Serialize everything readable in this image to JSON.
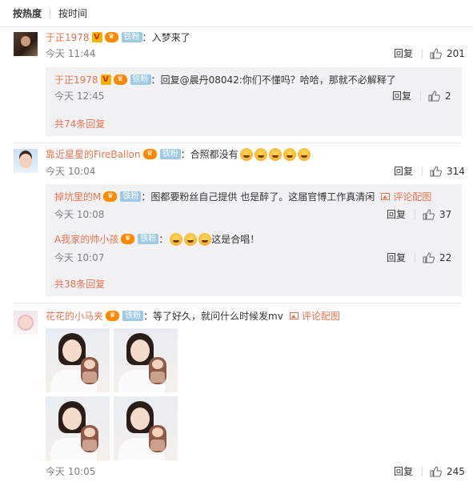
{
  "sort_bar": {
    "hot_label": "按热度",
    "time_label": "按时间"
  },
  "icons": {
    "like": "thumbs-up-icon",
    "pic": "image-icon",
    "verified": "verified-v-icon",
    "crown": "vip-crown-icon",
    "fan": "fan-badge-icon",
    "emoji": "laughing-emoji-icon"
  },
  "colors": {
    "username": "#eb7350",
    "time": "#808080",
    "fan_badge": "#9ecbe4",
    "reply_bg": "#f2f2f5"
  },
  "comments": [
    {
      "user": "于正1978",
      "badge_v": "V",
      "badge_fan": "铁粉",
      "colon": "：",
      "text": "入梦来了",
      "time": "今天 11:44",
      "reply_label": "回复",
      "likes": "201",
      "replies": [
        {
          "user": "于正1978",
          "badge_v": "V",
          "badge_fan": "铁粉",
          "colon": "：",
          "text": "回复@晨丹08042:你们不懂吗？哈哈，那就不必解释了",
          "time": "今天 12:45",
          "reply_label": "回复",
          "likes": "2"
        }
      ],
      "more": "共74条回复"
    },
    {
      "user": "靠近星星的FireBallon",
      "badge_fan": "铁粉",
      "colon": "：",
      "text": "合照都没有",
      "time": "今天 10:04",
      "reply_label": "回复",
      "likes": "314",
      "replies": [
        {
          "user": "掉坑里的M",
          "badge_fan": "铁粉",
          "colon": "：",
          "text": "图都要粉丝自己提供 也是醉了。这届官博工作真清闲",
          "pic_label": "评论配图",
          "time": "今天 10:08",
          "reply_label": "回复",
          "likes": "37"
        },
        {
          "user": "A我家的帅小孩",
          "badge_fan": "铁粉",
          "colon": "：",
          "text": "这是合唱！",
          "time": "今天 10:07",
          "reply_label": "回复",
          "likes": "22"
        }
      ],
      "more": "共38条回复"
    },
    {
      "user": "花花的小马夹",
      "badge_fan": "铁粉",
      "colon": "：",
      "text": "等了好久，就问什么时候发mv",
      "pic_label": "评论配图",
      "time": "今天 10:05",
      "reply_label": "回复",
      "likes": "245"
    }
  ]
}
